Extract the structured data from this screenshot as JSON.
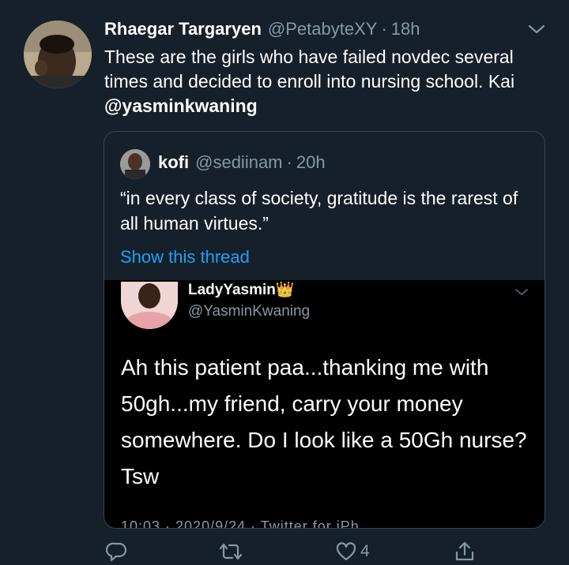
{
  "tweet": {
    "display_name": "Rhaegar Targaryen",
    "handle": "@PetabyteXY",
    "separator": "·",
    "time": "18h",
    "text_plain": "These are the girls who have failed novdec several times and decided to enroll into nursing school. Kai ",
    "mention": "@yasminkwaning"
  },
  "quoted_tweet": {
    "display_name": "kofi",
    "handle": "@sediinam",
    "separator": "·",
    "time": "20h",
    "text": "“in every class of society, gratitude is the rarest of all human virtues.”",
    "show_thread": "Show this thread"
  },
  "embedded_screenshot": {
    "display_name": "LadyYasmin",
    "emoji": "👑",
    "handle": "@YasminKwaning",
    "text": "Ah this patient paa...thanking me with 50gh...my friend, carry your money somewhere. Do I look like a 50Gh nurse? Tsw",
    "footer_partial": "10:03 · 2020/9/24 · Twitter for iPh"
  },
  "actions": {
    "like_count": "4"
  },
  "colors": {
    "background": "#15202b",
    "secondary_text": "#8899a6",
    "link": "#1da1f2",
    "border": "#38444d"
  },
  "icons": [
    "user-avatar",
    "chevron-down-icon",
    "reply-icon",
    "retweet-icon",
    "like-icon",
    "share-icon"
  ]
}
